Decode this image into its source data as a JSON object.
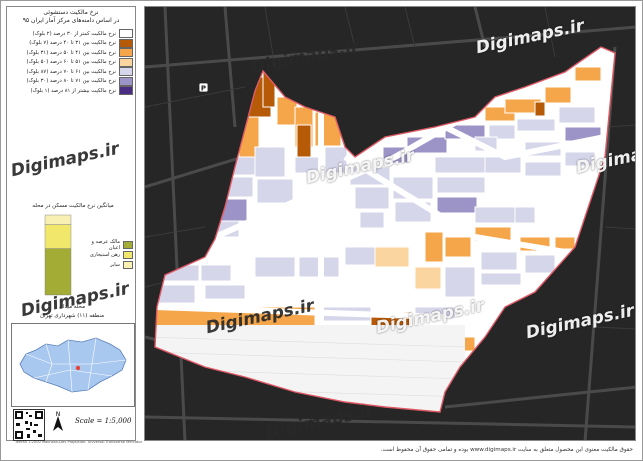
{
  "legend": {
    "title_line1": "نرخ مالکیت دستشوئی",
    "title_line2": "در اساس دامنه‌های مرکز آمار ایران ۹۵",
    "items": [
      {
        "label": "نرخ مالکیت کمتر از ۳۰ درصد (۲ بلوک)",
        "color": "#ffffff"
      },
      {
        "label": "نرخ مالکیت بین ۳۱ تا ۴۰ درصد (۷ بلوک)",
        "color": "#b65a07"
      },
      {
        "label": "نرخ مالکیت بین ۴۱ تا ۵۰ درصد (۳۱ بلوک)",
        "color": "#f5a54a"
      },
      {
        "label": "نرخ مالکیت بین ۵۱ تا ۶۰ درصد (۵۰ بلوک)",
        "color": "#fbd5a0"
      },
      {
        "label": "نرخ مالکیت بین ۶۱ تا ۷۰ درصد (۸۷ بلوک)",
        "color": "#d6d6eb"
      },
      {
        "label": "نرخ مالکیت بین ۷۱ تا ۸۰ درصد (۳۰ بلوک)",
        "color": "#9c94c7"
      },
      {
        "label": "نرخ مالکیت بیشتر از ۸۱ درصد (۱ بلوک)",
        "color": "#4b2c83"
      }
    ]
  },
  "chart": {
    "title": "میانگین نرخ مالکیت مسکن در محله",
    "legend": [
      {
        "label": "مالک عرصه و اعیان",
        "color": "#a3ac34"
      },
      {
        "label": "رهن استیجاری",
        "color": "#f1e86b"
      },
      {
        "label": "سایر",
        "color": "#f8efb2"
      }
    ]
  },
  "chart_data": {
    "type": "bar",
    "title": "میانگین نرخ مالکیت مسکن در محله",
    "categories": [
      ""
    ],
    "series": [
      {
        "name": "مالک عرصه و اعیان",
        "values": [
          58
        ]
      },
      {
        "name": "رهن استیجاری",
        "values": [
          30
        ]
      },
      {
        "name": "سایر",
        "values": [
          12
        ]
      }
    ],
    "stacked": true,
    "ylim": [
      0,
      100
    ],
    "grid": false
  },
  "location": {
    "neighborhood": "محله میدان",
    "district": "منطقه (۱۱) شهرداری تهران"
  },
  "scale_text": "Scale = 1:5,000",
  "north_letter": "N",
  "credit_left": "Tehran 1:2000 Makhzan-Dev  Projection: Universal Transverse Mercator",
  "bottom_note": "حقوق مالکیت معنوی این محصول متعلق به سایت www.digimaps.ir بوده و تمامی حقوق آن محفوظ است.",
  "watermark": "Digimaps.ir",
  "colors": {
    "boundary": "#e05a66",
    "street": "#ffffff",
    "background": "#262626",
    "block_default": "#d6d6eb"
  }
}
